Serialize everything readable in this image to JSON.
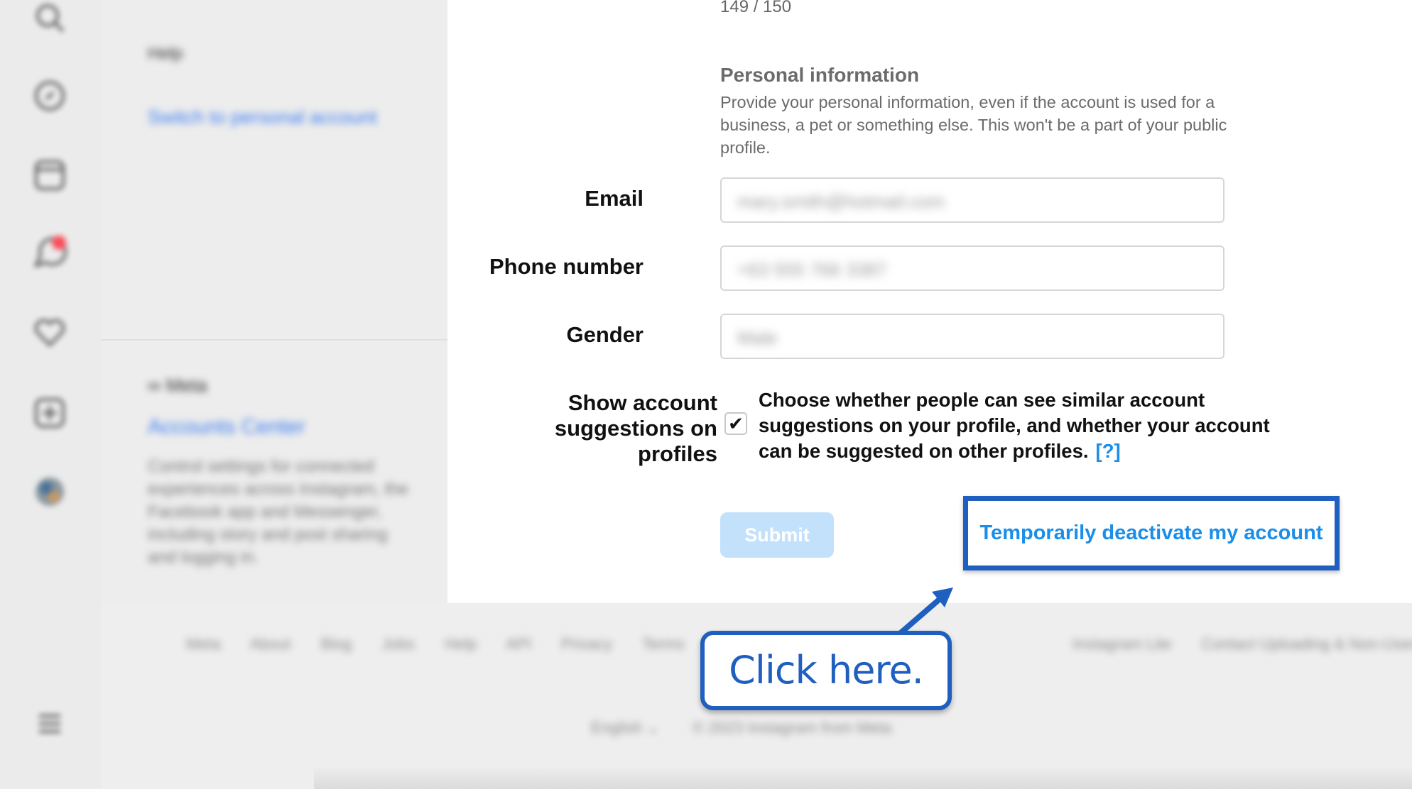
{
  "app": {
    "accent_color": "#1a8ee8",
    "annotation_color": "#1f5fbf"
  },
  "rail": {
    "icons": [
      "search-icon",
      "explore-icon",
      "reels-icon",
      "messages-icon",
      "notifications-icon",
      "create-icon",
      "profile-avatar",
      "menu-icon"
    ]
  },
  "nav_panel": {
    "help": "Help",
    "switch_account": "Switch to personal account",
    "meta": "∞ Meta",
    "accounts_center": "Accounts Center",
    "accounts_center_desc": "Control settings for connected experiences across Instagram, the Facebook app and Messenger, including story and post sharing and logging in."
  },
  "form": {
    "bio_counter": "149 / 150",
    "personal_info_title": "Personal information",
    "personal_info_desc": "Provide your personal information, even if the account is used for a business, a pet or something else. This won't be a part of your public profile.",
    "email_label": "Email",
    "email_value": "mary.smith@hotmail.com",
    "phone_label": "Phone number",
    "phone_value": "+63 555 766 3387",
    "gender_label": "Gender",
    "gender_value": "Male",
    "suggestions_label": "Show account suggestions on profiles",
    "suggestions_checked": true,
    "suggestions_text": "Choose whether people can see similar account suggestions on your profile, and whether your account can be suggested on other profiles.",
    "suggestions_help": "[?]",
    "submit_label": "Submit",
    "deactivate_label": "Temporarily deactivate my account"
  },
  "footer": {
    "links": [
      "Meta",
      "About",
      "Blog",
      "Jobs",
      "Help",
      "API",
      "Privacy",
      "Terms"
    ],
    "links_right": [
      "Instagram Lite",
      "Contact Uploading & Non-Users"
    ],
    "language": "English ⌄",
    "copyright": "© 2023 Instagram from Meta"
  },
  "callout": {
    "text": "Click here."
  }
}
